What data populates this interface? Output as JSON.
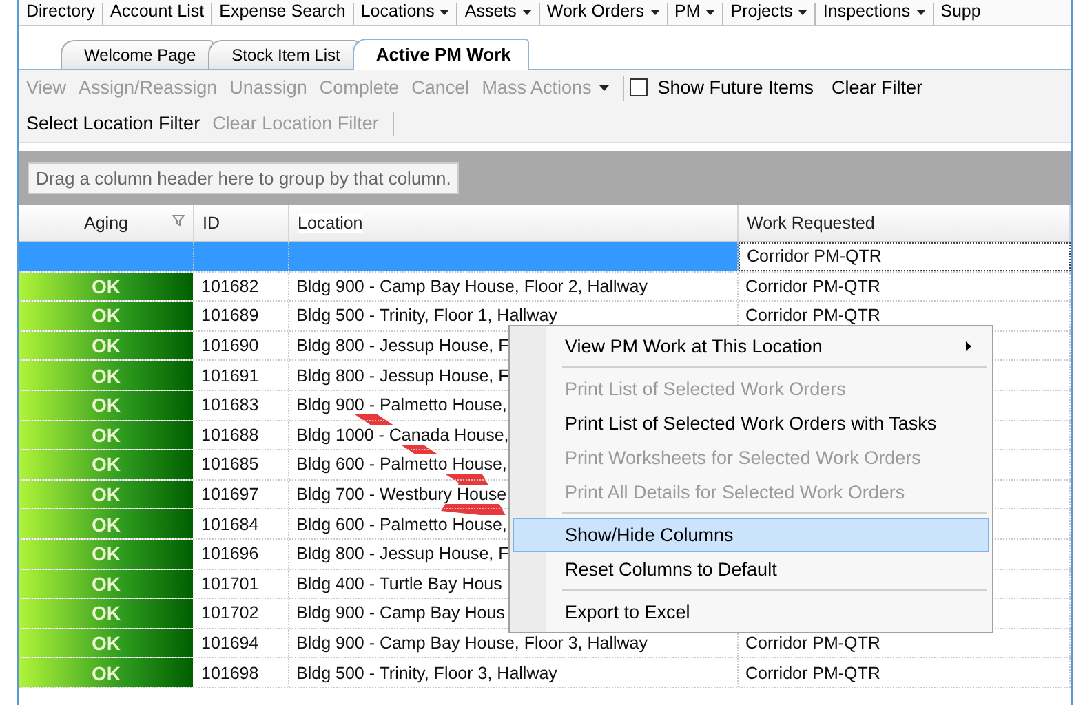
{
  "menu_bar": [
    {
      "label": "Directory",
      "dropdown": false
    },
    {
      "label": "Account List",
      "dropdown": false
    },
    {
      "label": "Expense Search",
      "dropdown": false
    },
    {
      "label": "Locations",
      "dropdown": true
    },
    {
      "label": "Assets",
      "dropdown": true
    },
    {
      "label": "Work Orders",
      "dropdown": true
    },
    {
      "label": "PM",
      "dropdown": true
    },
    {
      "label": "Projects",
      "dropdown": true
    },
    {
      "label": "Inspections",
      "dropdown": true
    },
    {
      "label": "Supp",
      "dropdown": false
    }
  ],
  "tabs": [
    {
      "label": "Welcome Page",
      "selected": false
    },
    {
      "label": "Stock Item List",
      "selected": false
    },
    {
      "label": "Active PM Work",
      "selected": true
    }
  ],
  "toolbar": [
    {
      "kind": "button",
      "label": "View",
      "disabled": true
    },
    {
      "kind": "button",
      "label": "Assign/Reassign",
      "disabled": true
    },
    {
      "kind": "button",
      "label": "Unassign",
      "disabled": true
    },
    {
      "kind": "button",
      "label": "Complete",
      "disabled": true
    },
    {
      "kind": "button",
      "label": "Cancel",
      "disabled": true
    },
    {
      "kind": "dropdown",
      "label": "Mass Actions",
      "disabled": true
    },
    {
      "kind": "checkbox",
      "label": "Show Future Items",
      "checked": false
    },
    {
      "kind": "button",
      "label": "Clear Filter",
      "disabled": false
    }
  ],
  "location_toolbar": [
    {
      "label": "Select Location Filter",
      "disabled": false
    },
    {
      "label": "Clear Location Filter",
      "disabled": true
    }
  ],
  "group_panel": {
    "placeholder": "Drag a column header here to group by that column."
  },
  "table": {
    "columns": [
      "Aging",
      "ID",
      "Location",
      "Work Requested"
    ],
    "rows": [
      {
        "work_requested": "Corridor PM-QTR",
        "selected": true
      },
      {
        "aging": "OK",
        "id": "101682",
        "location": "Bldg 900 - Camp Bay House, Floor 2, Hallway",
        "work_requested": "Corridor PM-QTR",
        "selected": false
      },
      {
        "aging": "OK",
        "id": "101689",
        "location": "Bldg 500 - Trinity, Floor 1, Hallway",
        "work_requested": "Corridor PM-QTR",
        "selected": false
      },
      {
        "aging": "OK",
        "id": "101690",
        "location": "Bldg 800 - Jessup House, F",
        "selected": false
      },
      {
        "aging": "OK",
        "id": "101691",
        "location": "Bldg 800 - Jessup House, F",
        "selected": false
      },
      {
        "aging": "OK",
        "id": "101683",
        "location": "Bldg 900 - Palmetto House,",
        "selected": false
      },
      {
        "aging": "OK",
        "id": "101688",
        "location": "Bldg 1000 - Canada House,",
        "selected": false
      },
      {
        "aging": "OK",
        "id": "101685",
        "location": "Bldg 600 - Palmetto House,",
        "selected": false
      },
      {
        "aging": "OK",
        "id": "101697",
        "location": "Bldg 700 - Westbury House",
        "selected": false
      },
      {
        "aging": "OK",
        "id": "101684",
        "location": "Bldg 600 - Palmetto House,",
        "selected": false
      },
      {
        "aging": "OK",
        "id": "101696",
        "location": "Bldg 800 - Jessup House, F",
        "selected": false
      },
      {
        "aging": "OK",
        "id": "101701",
        "location": "Bldg 400 - Turtle Bay Hous",
        "selected": false
      },
      {
        "aging": "OK",
        "id": "101702",
        "location": "Bldg 900 - Camp Bay Hous",
        "selected": false
      },
      {
        "aging": "OK",
        "id": "101694",
        "location": "Bldg 900 - Camp Bay House, Floor 3, Hallway",
        "work_requested": "Corridor PM-QTR",
        "selected": false
      },
      {
        "aging": "OK",
        "id": "101698",
        "location": "Bldg 500 - Trinity, Floor 3, Hallway",
        "work_requested": "Corridor PM-QTR",
        "selected": false
      }
    ]
  },
  "context_menu": [
    {
      "kind": "item",
      "label": "View PM Work at This Location",
      "disabled": false,
      "submenu": true,
      "selected": false
    },
    {
      "kind": "separator"
    },
    {
      "kind": "item",
      "label": "Print List of Selected Work Orders",
      "disabled": true,
      "submenu": false,
      "selected": false
    },
    {
      "kind": "item",
      "label": "Print List of Selected Work Orders with Tasks",
      "disabled": false,
      "submenu": false,
      "selected": false
    },
    {
      "kind": "item",
      "label": "Print Worksheets for Selected Work Orders",
      "disabled": true,
      "submenu": false,
      "selected": false
    },
    {
      "kind": "item",
      "label": "Print All Details for Selected Work Orders",
      "disabled": true,
      "submenu": false,
      "selected": false
    },
    {
      "kind": "separator"
    },
    {
      "kind": "item",
      "label": "Show/Hide Columns",
      "disabled": false,
      "submenu": false,
      "selected": true
    },
    {
      "kind": "item",
      "label": "Reset Columns to Default",
      "disabled": false,
      "submenu": false,
      "selected": false
    },
    {
      "kind": "separator"
    },
    {
      "kind": "item",
      "label": "Export to Excel",
      "disabled": false,
      "submenu": false,
      "selected": false
    }
  ]
}
